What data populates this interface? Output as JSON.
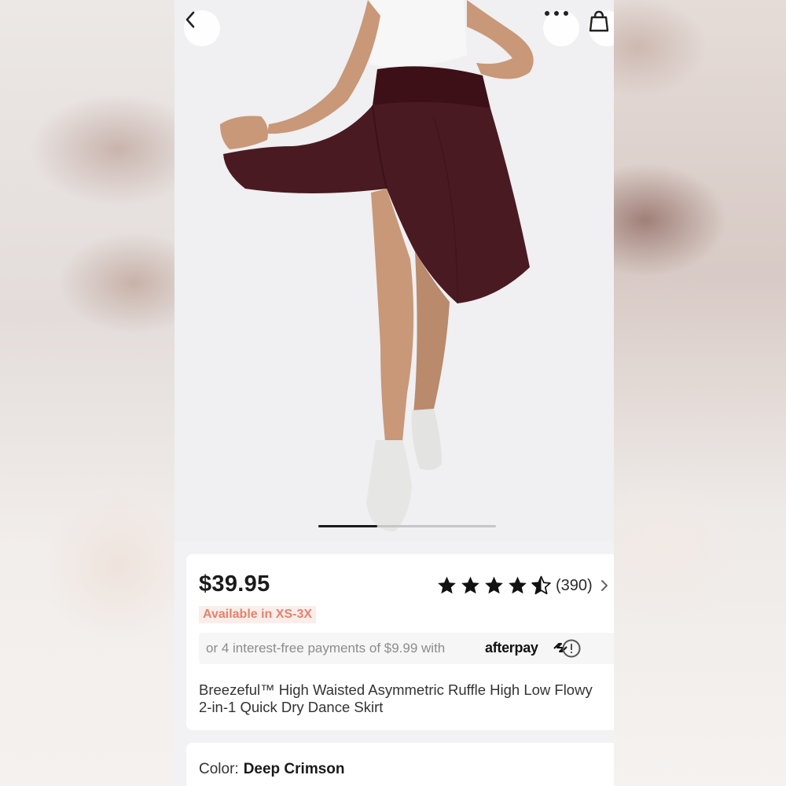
{
  "header": {
    "back_icon": "chevron-left-icon",
    "more_icon": "more-horizontal-icon",
    "cart_icon": "shopping-bag-icon"
  },
  "gallery": {
    "image_label": "product photo",
    "progress": 0.33
  },
  "product": {
    "price": "$39.95",
    "availability": "Available in XS-3X",
    "rating": 4.5,
    "review_count": "(390)",
    "installments_text": "or 4 interest-free payments of $9.99 with",
    "afterpay_brand": "afterpay",
    "title": "Breezeful™ High Waisted Asymmetric Ruffle High Low Flowy 2-in-1 Quick Dry Dance Skirt",
    "color_label": "Color:",
    "color_value": "Deep Crimson"
  },
  "colors": {
    "accent_badge_bg": "#fbeeea",
    "accent_badge_text": "#e2836e",
    "skirt": "#4a1a22",
    "star": "#111111"
  }
}
